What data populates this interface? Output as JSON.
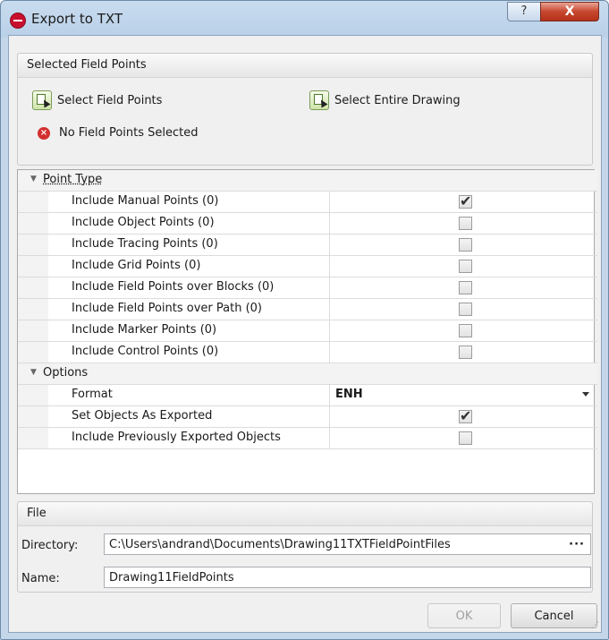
{
  "window": {
    "title": "Export to TXT",
    "help_glyph": "?",
    "close_glyph": "X"
  },
  "selected": {
    "header": "Selected Field Points",
    "select_field_points": "Select Field Points",
    "select_entire_drawing": "Select Entire Drawing",
    "status": "No Field Points Selected",
    "status_glyph": "×"
  },
  "grid": {
    "point_type": {
      "label": "Point Type",
      "toggle": "▼",
      "rows": [
        {
          "label": "Include Manual Points  (0)",
          "checked": true
        },
        {
          "label": "Include Object Points  (0)",
          "checked": false
        },
        {
          "label": "Include Tracing Points  (0)",
          "checked": false
        },
        {
          "label": "Include Grid Points  (0)",
          "checked": false
        },
        {
          "label": "Include Field Points over Blocks  (0)",
          "checked": false
        },
        {
          "label": "Include Field Points over Path  (0)",
          "checked": false
        },
        {
          "label": "Include Marker Points  (0)",
          "checked": false
        },
        {
          "label": "Include Control Points  (0)",
          "checked": false
        }
      ]
    },
    "options": {
      "label": "Options",
      "toggle": "▼",
      "format_label": "Format",
      "format_value": "ENH",
      "set_exported_label": "Set Objects As Exported",
      "set_exported_checked": true,
      "include_prev_label": "Include Previously Exported Objects",
      "include_prev_checked": false
    }
  },
  "file": {
    "header": "File",
    "directory_label": "Directory:",
    "directory_value": "C:\\Users\\andrand\\Documents\\Drawing11TXTFieldPointFiles",
    "browse_glyph": "···",
    "name_label": "Name:",
    "name_value": "Drawing11FieldPoints"
  },
  "buttons": {
    "ok": "OK",
    "cancel": "Cancel"
  },
  "colors": {
    "accent": "#c8102e",
    "error": "#d32f2f"
  }
}
